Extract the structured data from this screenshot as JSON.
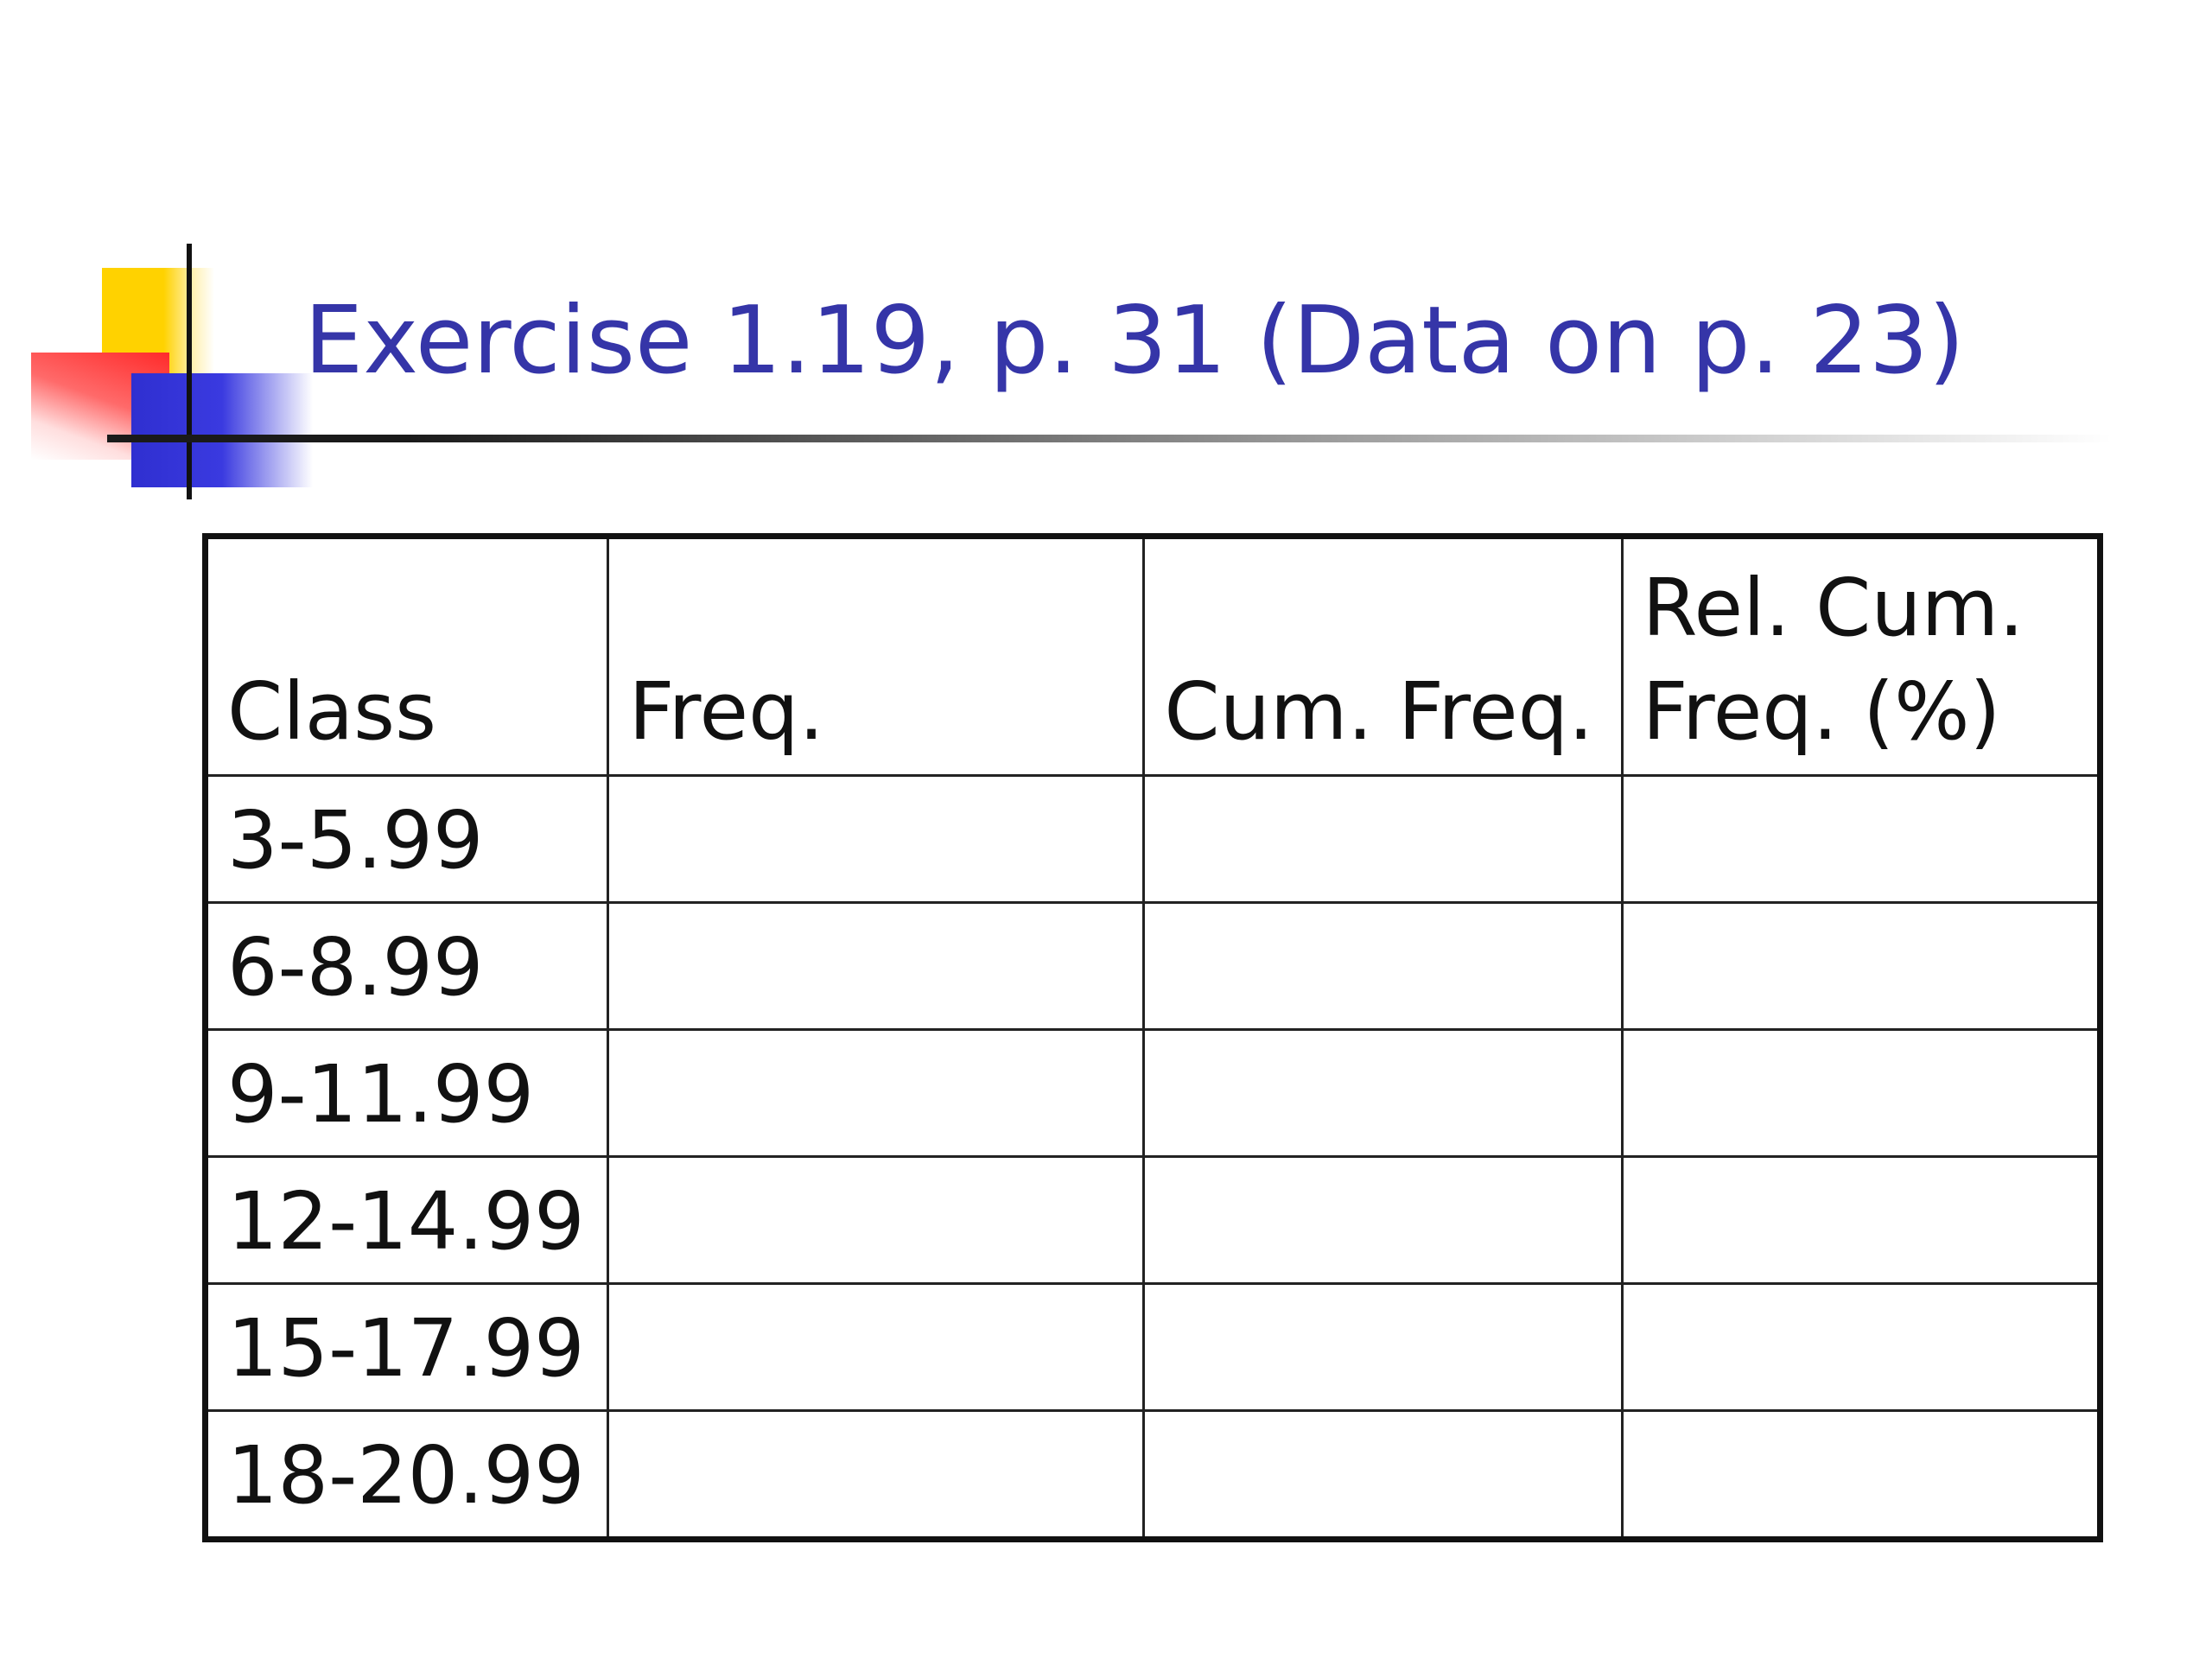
{
  "slide": {
    "title": "Exercise 1.19, p. 31 (Data on p. 23)"
  },
  "table": {
    "headers": [
      "Class",
      "Freq.",
      "Cum. Freq.",
      "Rel. Cum. Freq. (%)"
    ],
    "rows": [
      [
        "3-5.99",
        "",
        "",
        ""
      ],
      [
        "6-8.99",
        "",
        "",
        ""
      ],
      [
        "9-11.99",
        "",
        "",
        ""
      ],
      [
        "12-14.99",
        "",
        "",
        ""
      ],
      [
        "15-17.99",
        "",
        "",
        ""
      ],
      [
        "18-20.99",
        "",
        "",
        ""
      ]
    ]
  },
  "colors": {
    "title": "#3535a8",
    "logo_yellow": "#ffd200",
    "logo_red": "#ff2a2a",
    "logo_blue": "#2f2fd0"
  }
}
